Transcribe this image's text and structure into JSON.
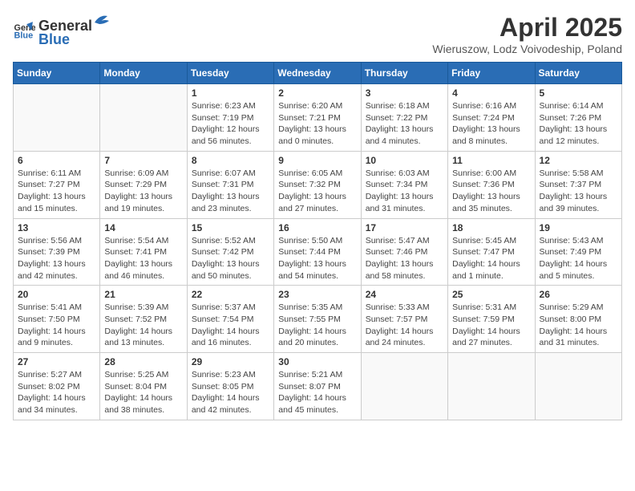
{
  "header": {
    "logo_general": "General",
    "logo_blue": "Blue",
    "title": "April 2025",
    "location": "Wieruszow, Lodz Voivodeship, Poland"
  },
  "weekdays": [
    "Sunday",
    "Monday",
    "Tuesday",
    "Wednesday",
    "Thursday",
    "Friday",
    "Saturday"
  ],
  "weeks": [
    [
      {
        "day": "",
        "info": ""
      },
      {
        "day": "",
        "info": ""
      },
      {
        "day": "1",
        "info": "Sunrise: 6:23 AM\nSunset: 7:19 PM\nDaylight: 12 hours and 56 minutes."
      },
      {
        "day": "2",
        "info": "Sunrise: 6:20 AM\nSunset: 7:21 PM\nDaylight: 13 hours and 0 minutes."
      },
      {
        "day": "3",
        "info": "Sunrise: 6:18 AM\nSunset: 7:22 PM\nDaylight: 13 hours and 4 minutes."
      },
      {
        "day": "4",
        "info": "Sunrise: 6:16 AM\nSunset: 7:24 PM\nDaylight: 13 hours and 8 minutes."
      },
      {
        "day": "5",
        "info": "Sunrise: 6:14 AM\nSunset: 7:26 PM\nDaylight: 13 hours and 12 minutes."
      }
    ],
    [
      {
        "day": "6",
        "info": "Sunrise: 6:11 AM\nSunset: 7:27 PM\nDaylight: 13 hours and 15 minutes."
      },
      {
        "day": "7",
        "info": "Sunrise: 6:09 AM\nSunset: 7:29 PM\nDaylight: 13 hours and 19 minutes."
      },
      {
        "day": "8",
        "info": "Sunrise: 6:07 AM\nSunset: 7:31 PM\nDaylight: 13 hours and 23 minutes."
      },
      {
        "day": "9",
        "info": "Sunrise: 6:05 AM\nSunset: 7:32 PM\nDaylight: 13 hours and 27 minutes."
      },
      {
        "day": "10",
        "info": "Sunrise: 6:03 AM\nSunset: 7:34 PM\nDaylight: 13 hours and 31 minutes."
      },
      {
        "day": "11",
        "info": "Sunrise: 6:00 AM\nSunset: 7:36 PM\nDaylight: 13 hours and 35 minutes."
      },
      {
        "day": "12",
        "info": "Sunrise: 5:58 AM\nSunset: 7:37 PM\nDaylight: 13 hours and 39 minutes."
      }
    ],
    [
      {
        "day": "13",
        "info": "Sunrise: 5:56 AM\nSunset: 7:39 PM\nDaylight: 13 hours and 42 minutes."
      },
      {
        "day": "14",
        "info": "Sunrise: 5:54 AM\nSunset: 7:41 PM\nDaylight: 13 hours and 46 minutes."
      },
      {
        "day": "15",
        "info": "Sunrise: 5:52 AM\nSunset: 7:42 PM\nDaylight: 13 hours and 50 minutes."
      },
      {
        "day": "16",
        "info": "Sunrise: 5:50 AM\nSunset: 7:44 PM\nDaylight: 13 hours and 54 minutes."
      },
      {
        "day": "17",
        "info": "Sunrise: 5:47 AM\nSunset: 7:46 PM\nDaylight: 13 hours and 58 minutes."
      },
      {
        "day": "18",
        "info": "Sunrise: 5:45 AM\nSunset: 7:47 PM\nDaylight: 14 hours and 1 minute."
      },
      {
        "day": "19",
        "info": "Sunrise: 5:43 AM\nSunset: 7:49 PM\nDaylight: 14 hours and 5 minutes."
      }
    ],
    [
      {
        "day": "20",
        "info": "Sunrise: 5:41 AM\nSunset: 7:50 PM\nDaylight: 14 hours and 9 minutes."
      },
      {
        "day": "21",
        "info": "Sunrise: 5:39 AM\nSunset: 7:52 PM\nDaylight: 14 hours and 13 minutes."
      },
      {
        "day": "22",
        "info": "Sunrise: 5:37 AM\nSunset: 7:54 PM\nDaylight: 14 hours and 16 minutes."
      },
      {
        "day": "23",
        "info": "Sunrise: 5:35 AM\nSunset: 7:55 PM\nDaylight: 14 hours and 20 minutes."
      },
      {
        "day": "24",
        "info": "Sunrise: 5:33 AM\nSunset: 7:57 PM\nDaylight: 14 hours and 24 minutes."
      },
      {
        "day": "25",
        "info": "Sunrise: 5:31 AM\nSunset: 7:59 PM\nDaylight: 14 hours and 27 minutes."
      },
      {
        "day": "26",
        "info": "Sunrise: 5:29 AM\nSunset: 8:00 PM\nDaylight: 14 hours and 31 minutes."
      }
    ],
    [
      {
        "day": "27",
        "info": "Sunrise: 5:27 AM\nSunset: 8:02 PM\nDaylight: 14 hours and 34 minutes."
      },
      {
        "day": "28",
        "info": "Sunrise: 5:25 AM\nSunset: 8:04 PM\nDaylight: 14 hours and 38 minutes."
      },
      {
        "day": "29",
        "info": "Sunrise: 5:23 AM\nSunset: 8:05 PM\nDaylight: 14 hours and 42 minutes."
      },
      {
        "day": "30",
        "info": "Sunrise: 5:21 AM\nSunset: 8:07 PM\nDaylight: 14 hours and 45 minutes."
      },
      {
        "day": "",
        "info": ""
      },
      {
        "day": "",
        "info": ""
      },
      {
        "day": "",
        "info": ""
      }
    ]
  ]
}
